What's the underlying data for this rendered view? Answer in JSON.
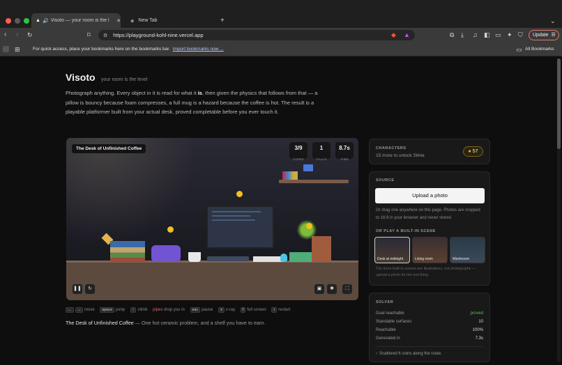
{
  "browser": {
    "tabs": [
      {
        "title": "Visoto — your room is the l",
        "active": true
      },
      {
        "title": "New Tab",
        "active": false
      }
    ],
    "url": "https://playground-kohl-nine.vercel.app",
    "update_label": "Update",
    "bookmarks_prompt": "For quick access, place your bookmarks here on the bookmarks bar.",
    "import_link": "Import bookmarks now ...",
    "all_bookmarks": "All Bookmarks"
  },
  "header": {
    "title": "Visoto",
    "tagline": "your room is the level",
    "intro_before": "Photograph anything. Every object in it is read for what it ",
    "intro_em": "is",
    "intro_after": ", then given the physics that follows from that — a pillow is bouncy because foam compresses, a full mug is a hazard because the coffee is hot. The result is a playable platformer built from your actual desk, proved completable before you ever touch it."
  },
  "game": {
    "level_name": "The Desk of Unfinished Coffee",
    "hud": [
      {
        "value": "3/9",
        "label": "COINS"
      },
      {
        "value": "1",
        "label": "FALLS"
      },
      {
        "value": "8.7s",
        "label": "TIME"
      }
    ],
    "controls": [
      {
        "keys": [
          "←",
          "→"
        ],
        "action": "move"
      },
      {
        "keys": [
          "space"
        ],
        "action": "jump"
      },
      {
        "keys": [
          "↑"
        ],
        "action": "climb"
      },
      {
        "keys": [],
        "highlight": "pipes",
        "action": "drop you in"
      },
      {
        "keys": [
          "esc"
        ],
        "action": "pause"
      },
      {
        "keys": [
          "x"
        ],
        "action": "x-ray"
      },
      {
        "keys": [
          "f"
        ],
        "action": "full screen"
      },
      {
        "keys": [
          "r"
        ],
        "action": "restart"
      }
    ],
    "caption_title": "The Desk of Unfinished Coffee",
    "caption_text": " — One hot ceramic problem, and a shelf you have to earn."
  },
  "characters": {
    "heading": "CHARACTERS",
    "subtext": "15 more to unlock Slime",
    "coin_count": "57"
  },
  "source": {
    "heading": "SOURCE",
    "upload_label": "Upload a photo",
    "hint": "Or drag one anywhere on this page. Photos are cropped to 16:9 in your browser and never stored.",
    "builtin_heading": "OR PLAY A BUILT-IN SCENE",
    "scenes": [
      {
        "label": "Desk at midnight",
        "selected": true
      },
      {
        "label": "Living room",
        "selected": false
      },
      {
        "label": "Washroom",
        "selected": false
      }
    ],
    "note": "The three built-in scenes are illustrations, not photographs — upload a photo for the real thing."
  },
  "solver": {
    "heading": "SOLVER",
    "rows": [
      {
        "label": "Goal reachable",
        "value": "proved"
      },
      {
        "label": "Standable surfaces",
        "value": "10"
      },
      {
        "label": "Reachable",
        "value": "100%"
      },
      {
        "label": "Generated in",
        "value": "7.3s"
      }
    ],
    "footnote": "Scattered 6 coins along the route."
  },
  "colors": {
    "accent_green": "#5fbf5f",
    "coin_gold": "#f2c21b",
    "brave_orange": "#fb542b"
  }
}
